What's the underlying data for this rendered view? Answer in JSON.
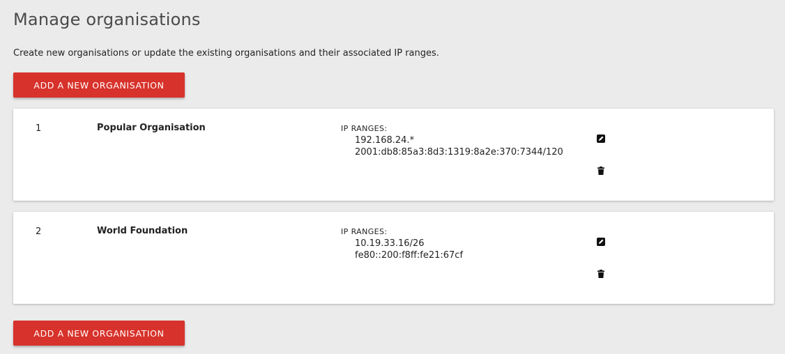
{
  "page": {
    "title": "Manage organisations",
    "intro": "Create new organisations or update the existing organisations and their associated IP ranges."
  },
  "actions": {
    "add_label": "Add a new organisation"
  },
  "organisations": [
    {
      "index": "1",
      "name": "Popular Organisation",
      "ip_label": "IP RANGES:",
      "ip_ranges": [
        "192.168.24.*",
        "2001:db8:85a3:8d3:1319:8a2e:370:7344/120"
      ],
      "icons": [
        "edit-icon",
        "trash-icon"
      ]
    },
    {
      "index": "2",
      "name": "World Foundation",
      "ip_label": "IP RANGES:",
      "ip_ranges": [
        "10.19.33.16/26",
        "fe80::200:f8ff:fe21:67cf"
      ],
      "icons": [
        "edit-icon",
        "trash-icon"
      ]
    }
  ],
  "colors": {
    "accent": "#d7322b",
    "background": "#ebebeb",
    "card": "#ffffff"
  }
}
